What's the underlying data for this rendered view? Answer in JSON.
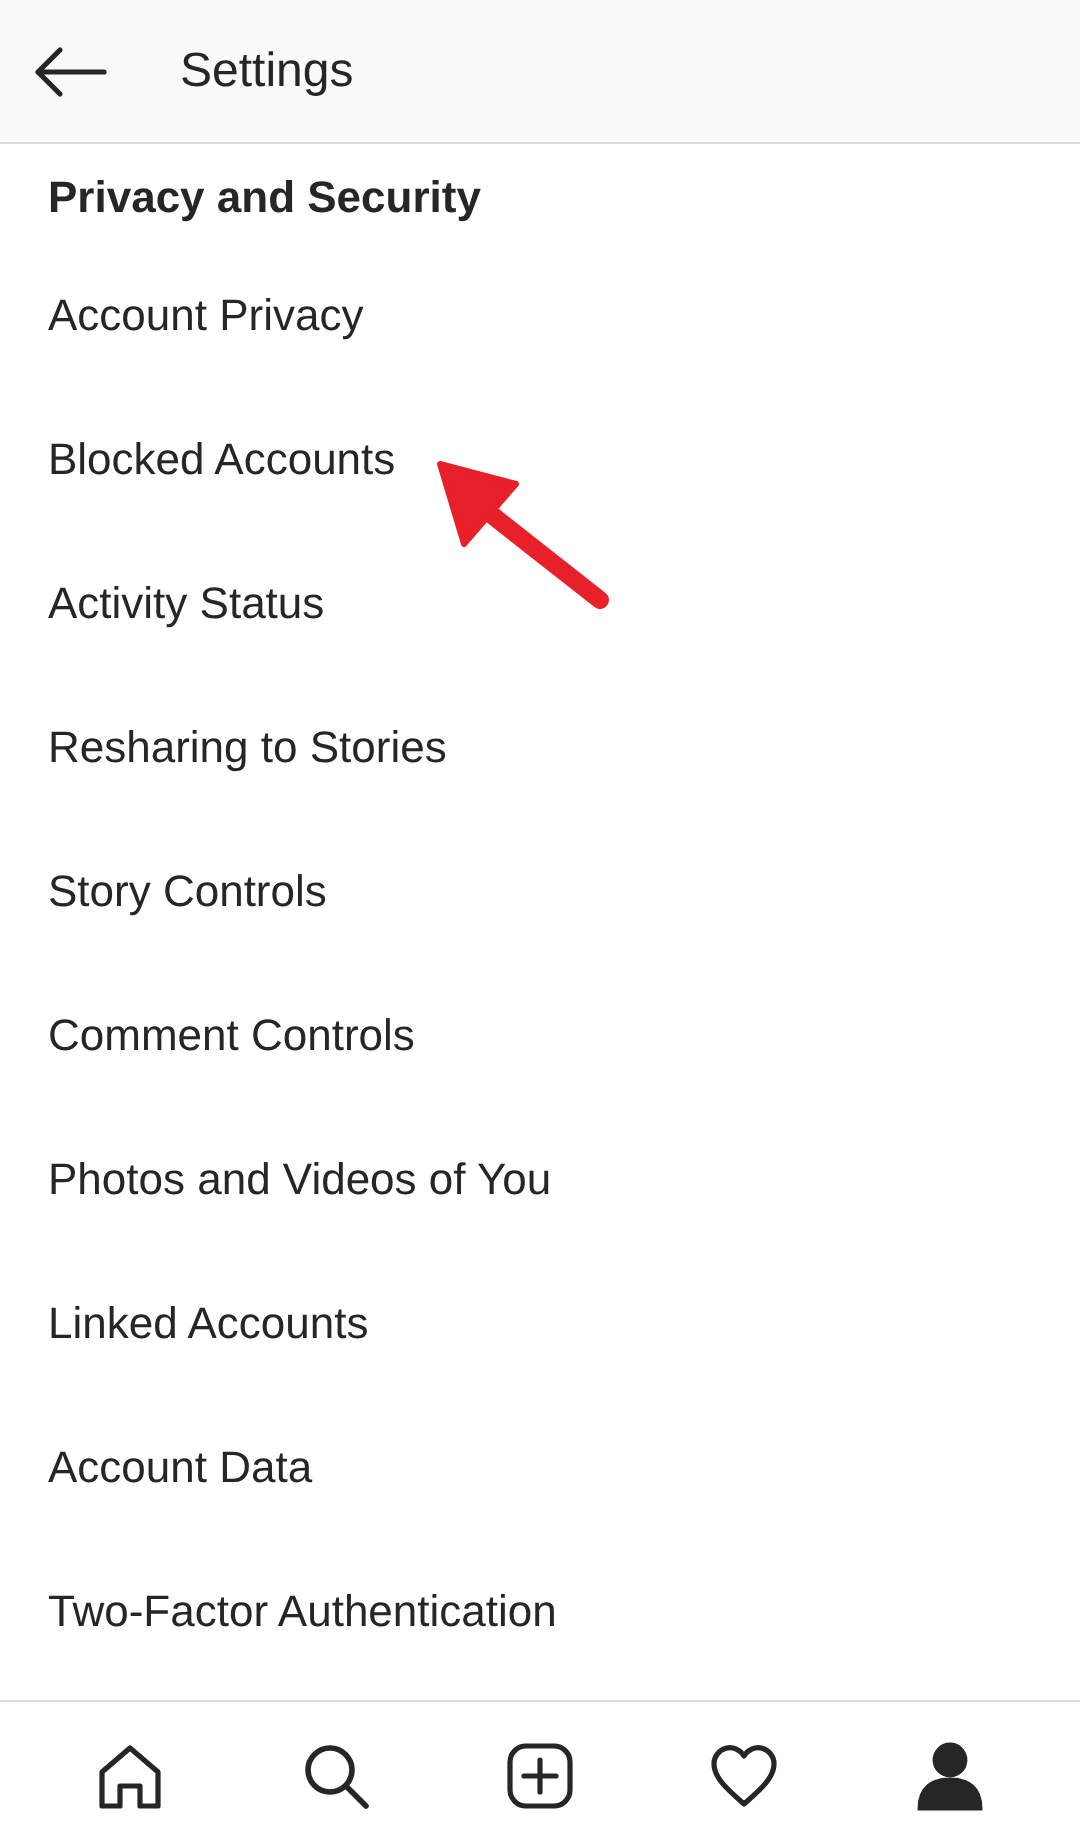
{
  "header": {
    "title": "Settings"
  },
  "section": {
    "heading": "Privacy and Security",
    "items": [
      {
        "label": "Account Privacy",
        "highlighted": false
      },
      {
        "label": "Blocked Accounts",
        "highlighted": true
      },
      {
        "label": "Activity Status",
        "highlighted": false
      },
      {
        "label": "Resharing to Stories",
        "highlighted": false
      },
      {
        "label": "Story Controls",
        "highlighted": false
      },
      {
        "label": "Comment Controls",
        "highlighted": false
      },
      {
        "label": "Photos and Videos of You",
        "highlighted": false
      },
      {
        "label": "Linked Accounts",
        "highlighted": false
      },
      {
        "label": "Account Data",
        "highlighted": false
      },
      {
        "label": "Two-Factor Authentication",
        "highlighted": false
      }
    ]
  },
  "bottom_nav": [
    {
      "kind": "home",
      "selected": false
    },
    {
      "kind": "search",
      "selected": false
    },
    {
      "kind": "add",
      "selected": false
    },
    {
      "kind": "activity",
      "selected": false
    },
    {
      "kind": "profile",
      "selected": true
    }
  ]
}
